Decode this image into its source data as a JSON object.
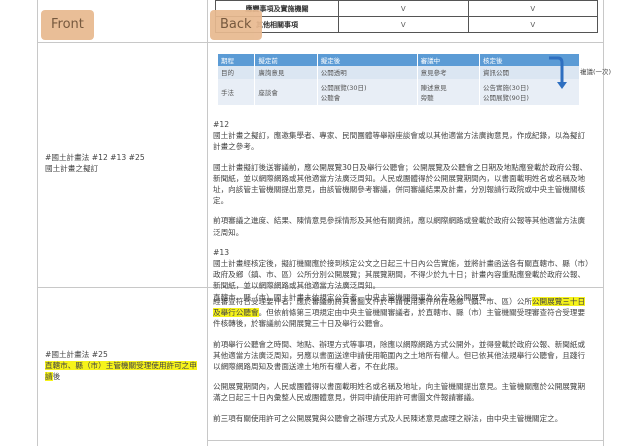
{
  "buttons": {
    "front": "Front",
    "back": "Back"
  },
  "top_table": {
    "rows": [
      {
        "label": "應變事項及實施機關",
        "c1": "V",
        "c2": "V"
      },
      {
        "label": "其他相關事項",
        "c1": "V",
        "c2": "V"
      }
    ]
  },
  "diagram": {
    "headers": [
      "期程",
      "擬定前",
      "擬定後",
      "審議中",
      "核定後"
    ],
    "rows": [
      [
        "目的",
        "廣詢意見",
        "公開透明",
        "意見參考",
        "資訊公開"
      ],
      [
        "手法",
        "座談會",
        "公開展覽(30日)\n公聽會",
        "陳述意見\n旁聽",
        "公告實施(30日)\n公開展覽(90日)"
      ]
    ],
    "note": "複議(一次)"
  },
  "row1": {
    "left_tag": "#國土計畫法 #12 #13 #25",
    "left_title": "國土計畫之擬訂",
    "paras": [
      "#12",
      "國土計畫之擬訂，應邀集學者、專家、民間團體等舉辦座談會或以其他適當方法廣詢意見，作成紀錄，以為擬訂計畫之參考。",
      "國土計畫擬訂後送審議前，應公開展覽30日及舉行公聽會；公開展覽及公聽會之日期及地點應登載於政府公報、新聞紙，並以網際網路或其他適當方法廣泛周知。人民或團體得於公開展覽期間內，以書面載明姓名或名稱及地址，向該管主管機關提出意見，由該管機關參考審議，併同審議結果及計畫，分別報請行政院或中央主管機關核定。",
      "前項審議之進度、結果、陳情意見參採情形及其他有關資訊，應以網際網路或登載於政府公報等其他適當方法廣泛周知。",
      "#13",
      "國土計畫經核定後，擬訂機關應於接到核定公文之日起三十日內公告實施，並將計畫函送各有關直轄市、縣（市）政府及鄉（鎮、市、區）公所分別公開展覽；其展覽期間，不得少於九十日；計畫內容重點應登載於政府公報、新聞紙，並以網際網路或其他適當方法廣泛周知。",
      "直轄市、縣（市）國土計畫未依規定公告者，中央主管機關得逕為公告及公開展覽。"
    ]
  },
  "row2": {
    "left_tag": "#國土計畫法 #25",
    "left_title_highlight": "直轄市、縣（市）主管機關受理使用許可之申請",
    "left_title_rest": "後",
    "p1_a": "經審查符合受理要件者，應於審議前將其書圖文件於申請使用案件所在地鄉（鎮、市、區）公所",
    "p1_hl": "公開展覽三十日及舉行公聽會",
    "p1_b": "。但依前條第三項規定由中央主管機關審議者，於直轄市、縣（市）主管機關受理審查符合受理要件核轉後，於審議前公開展覽三十日及舉行公聽會。",
    "paras": [
      "前項舉行公聽會之時間、地點、辦理方式等事項，除應以網際網路方式公開外，並得登載於政府公報、新聞紙或其他適當方法廣泛周知，另應以書面送達申請使用範圍內之土地所有權人。但已依其他法規舉行公聽會，且踐行以網際網路周知及書面送達土地所有權人者，不在此限。",
      "公開展覽期間內，人民或團體得以書面載明姓名或名稱及地址，向主管機關提出意見。主管機關應於公開展覽期滿之日起三十日內彙整人民或團體意見，併同申請使用許可書圖文件報請審議。",
      "前三項有關使用許可之公開展覽與公聽會之辦理方式及人民陳述意見處理之辦法，由中央主管機關定之。"
    ]
  }
}
